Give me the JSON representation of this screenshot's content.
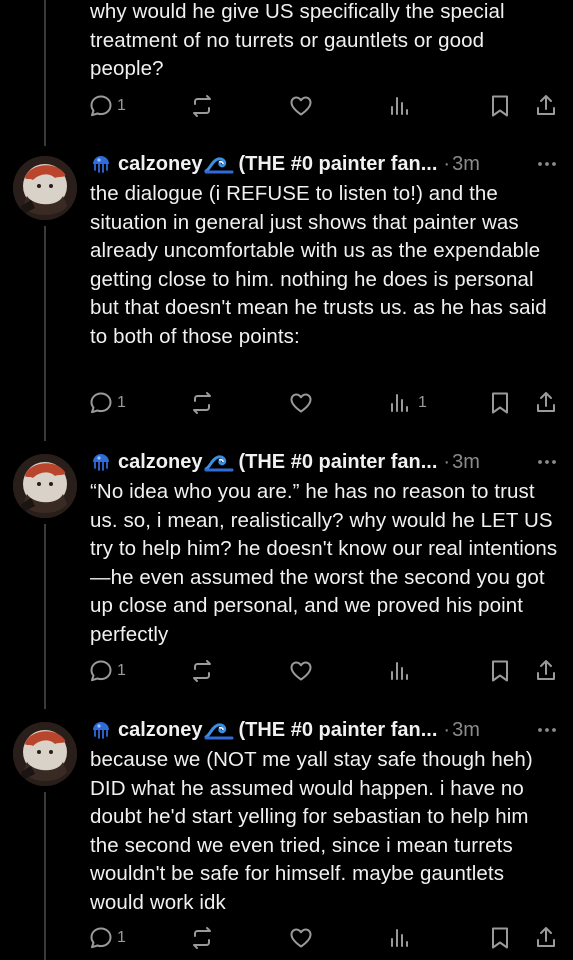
{
  "colors": {
    "background": "#000000",
    "text": "#f1f1f1",
    "muted": "#8b8b8b",
    "thread_line": "#3a3a3a",
    "bubble_accent": "#2f6bd9"
  },
  "partial_post": {
    "text": "why would he give US specifically the special treatment of no turrets or gauntlets or good people?",
    "actions": {
      "replies": "1",
      "reposts": "",
      "likes": "",
      "views": "",
      "bookmark": "",
      "share": ""
    }
  },
  "posts": [
    {
      "username": "calzoney",
      "display_name": "(THE #0 painter fan...",
      "separator": "·",
      "time": "3m",
      "text": "the dialogue (i REFUSE to listen to!) and the situation in general just shows that painter was already uncomfortable with us as the expendable getting close to him. nothing he does is personal but that doesn't mean he trusts us. as he has said to both of those points:",
      "actions": {
        "replies": "1",
        "reposts": "",
        "likes": "",
        "views": "1"
      }
    },
    {
      "username": "calzoney",
      "display_name": "(THE #0 painter fan...",
      "separator": "·",
      "time": "3m",
      "text": "“No idea who you are.” he has no reason to trust us. so, i mean, realistically? why would he LET US try to help him? he doesn't know our real intentions—he even assumed the worst the second you got up close and personal, and we proved his point perfectly",
      "actions": {
        "replies": "1",
        "reposts": "",
        "likes": "",
        "views": ""
      }
    },
    {
      "username": "calzoney",
      "display_name": "(THE #0 painter fan...",
      "separator": "·",
      "time": "3m",
      "text": "because we (NOT me yall stay safe though heh) DID what he assumed would happen. i have no doubt he'd start yelling for sebastian to help him the second we even tried, since i mean turrets wouldn't be safe for himself. maybe gauntlets would work idk",
      "actions": {
        "replies": "1",
        "reposts": "",
        "likes": "",
        "views": ""
      }
    }
  ]
}
